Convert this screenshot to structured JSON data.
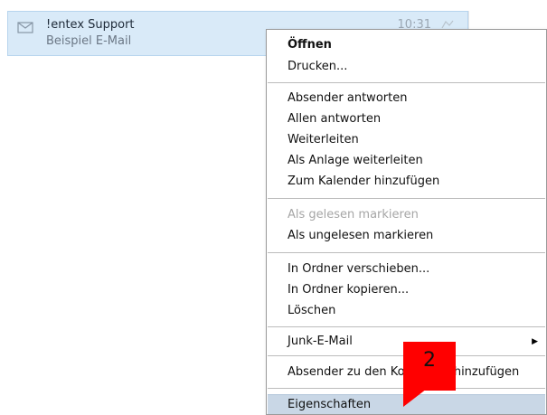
{
  "mail": {
    "sender": "!entex Support",
    "subject": "Beispiel E-Mail",
    "time": "10:31",
    "icon": "envelope-icon",
    "flag_icon": "flag-icon"
  },
  "menu": {
    "items": [
      {
        "label": "Öffnen",
        "bold": true
      },
      {
        "label": "Drucken..."
      },
      {
        "label": "Absender antworten"
      },
      {
        "label": "Allen antworten"
      },
      {
        "label": "Weiterleiten"
      },
      {
        "label": "Als Anlage weiterleiten"
      },
      {
        "label": "Zum Kalender hinzufügen"
      },
      {
        "label": "Als gelesen markieren",
        "disabled": true
      },
      {
        "label": "Als ungelesen markieren"
      },
      {
        "label": "In Ordner verschieben..."
      },
      {
        "label": "In Ordner kopieren..."
      },
      {
        "label": "Löschen"
      },
      {
        "label": "Junk-E-Mail",
        "submenu": true
      },
      {
        "label": "Absender zu den Kontakten hinzufügen"
      },
      {
        "label": "Eigenschaften",
        "highlighted": true
      }
    ]
  },
  "callout": {
    "text": "2",
    "color": "#ff0000"
  },
  "colors": {
    "selection": "#d9eaf8",
    "menu_highlight": "#c9d7e6"
  }
}
